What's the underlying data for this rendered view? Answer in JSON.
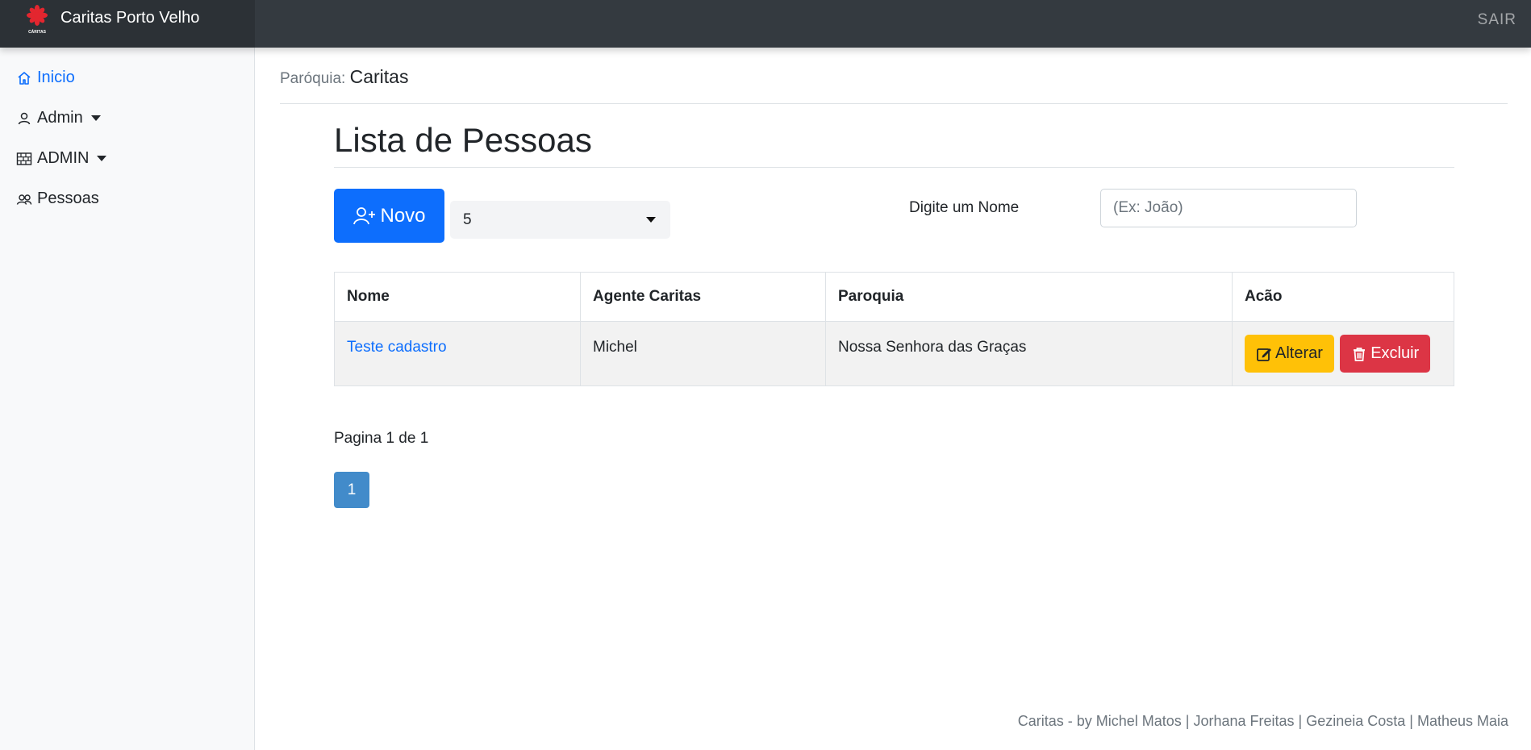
{
  "header": {
    "brand_name": "Caritas Porto Velho",
    "logo_text": "CÁRITAS",
    "logout_label": "SAIR"
  },
  "sidebar": {
    "items": [
      {
        "label": "Inicio",
        "icon": "home-icon",
        "active": true
      },
      {
        "label": "Admin",
        "icon": "person-icon",
        "dropdown": true
      },
      {
        "label": "ADMIN",
        "icon": "bricks-icon",
        "dropdown": true
      },
      {
        "label": "Pessoas",
        "icon": "people-icon"
      }
    ]
  },
  "main": {
    "parish_label": "Paróquia:",
    "parish_value": "Caritas",
    "title": "Lista de Pessoas",
    "new_button_label": "Novo",
    "page_size_value": "5",
    "filter_label": "Digite um Nome",
    "filter_placeholder": "(Ex: João)",
    "filter_value": ""
  },
  "table": {
    "headers": [
      "Nome",
      "Agente Caritas",
      "Paroquia",
      "Acão"
    ],
    "rows": [
      {
        "nome": "Teste cadastro",
        "agente": "Michel",
        "paroquia": "Nossa Senhora das Graças",
        "edit_label": "Alterar",
        "delete_label": "Excluir"
      }
    ]
  },
  "pagination": {
    "text": "Pagina 1 de 1",
    "current_page": "1"
  },
  "footer": {
    "credits": "Caritas - by Michel Matos | Jorhana Freitas | Gezineia Costa | Matheus Maia"
  },
  "colors": {
    "primary": "#0d6efd",
    "warning": "#ffc107",
    "danger": "#dc3545",
    "topbar": "#343a40",
    "page_button": "#428bca",
    "logo": "#e3262f"
  }
}
